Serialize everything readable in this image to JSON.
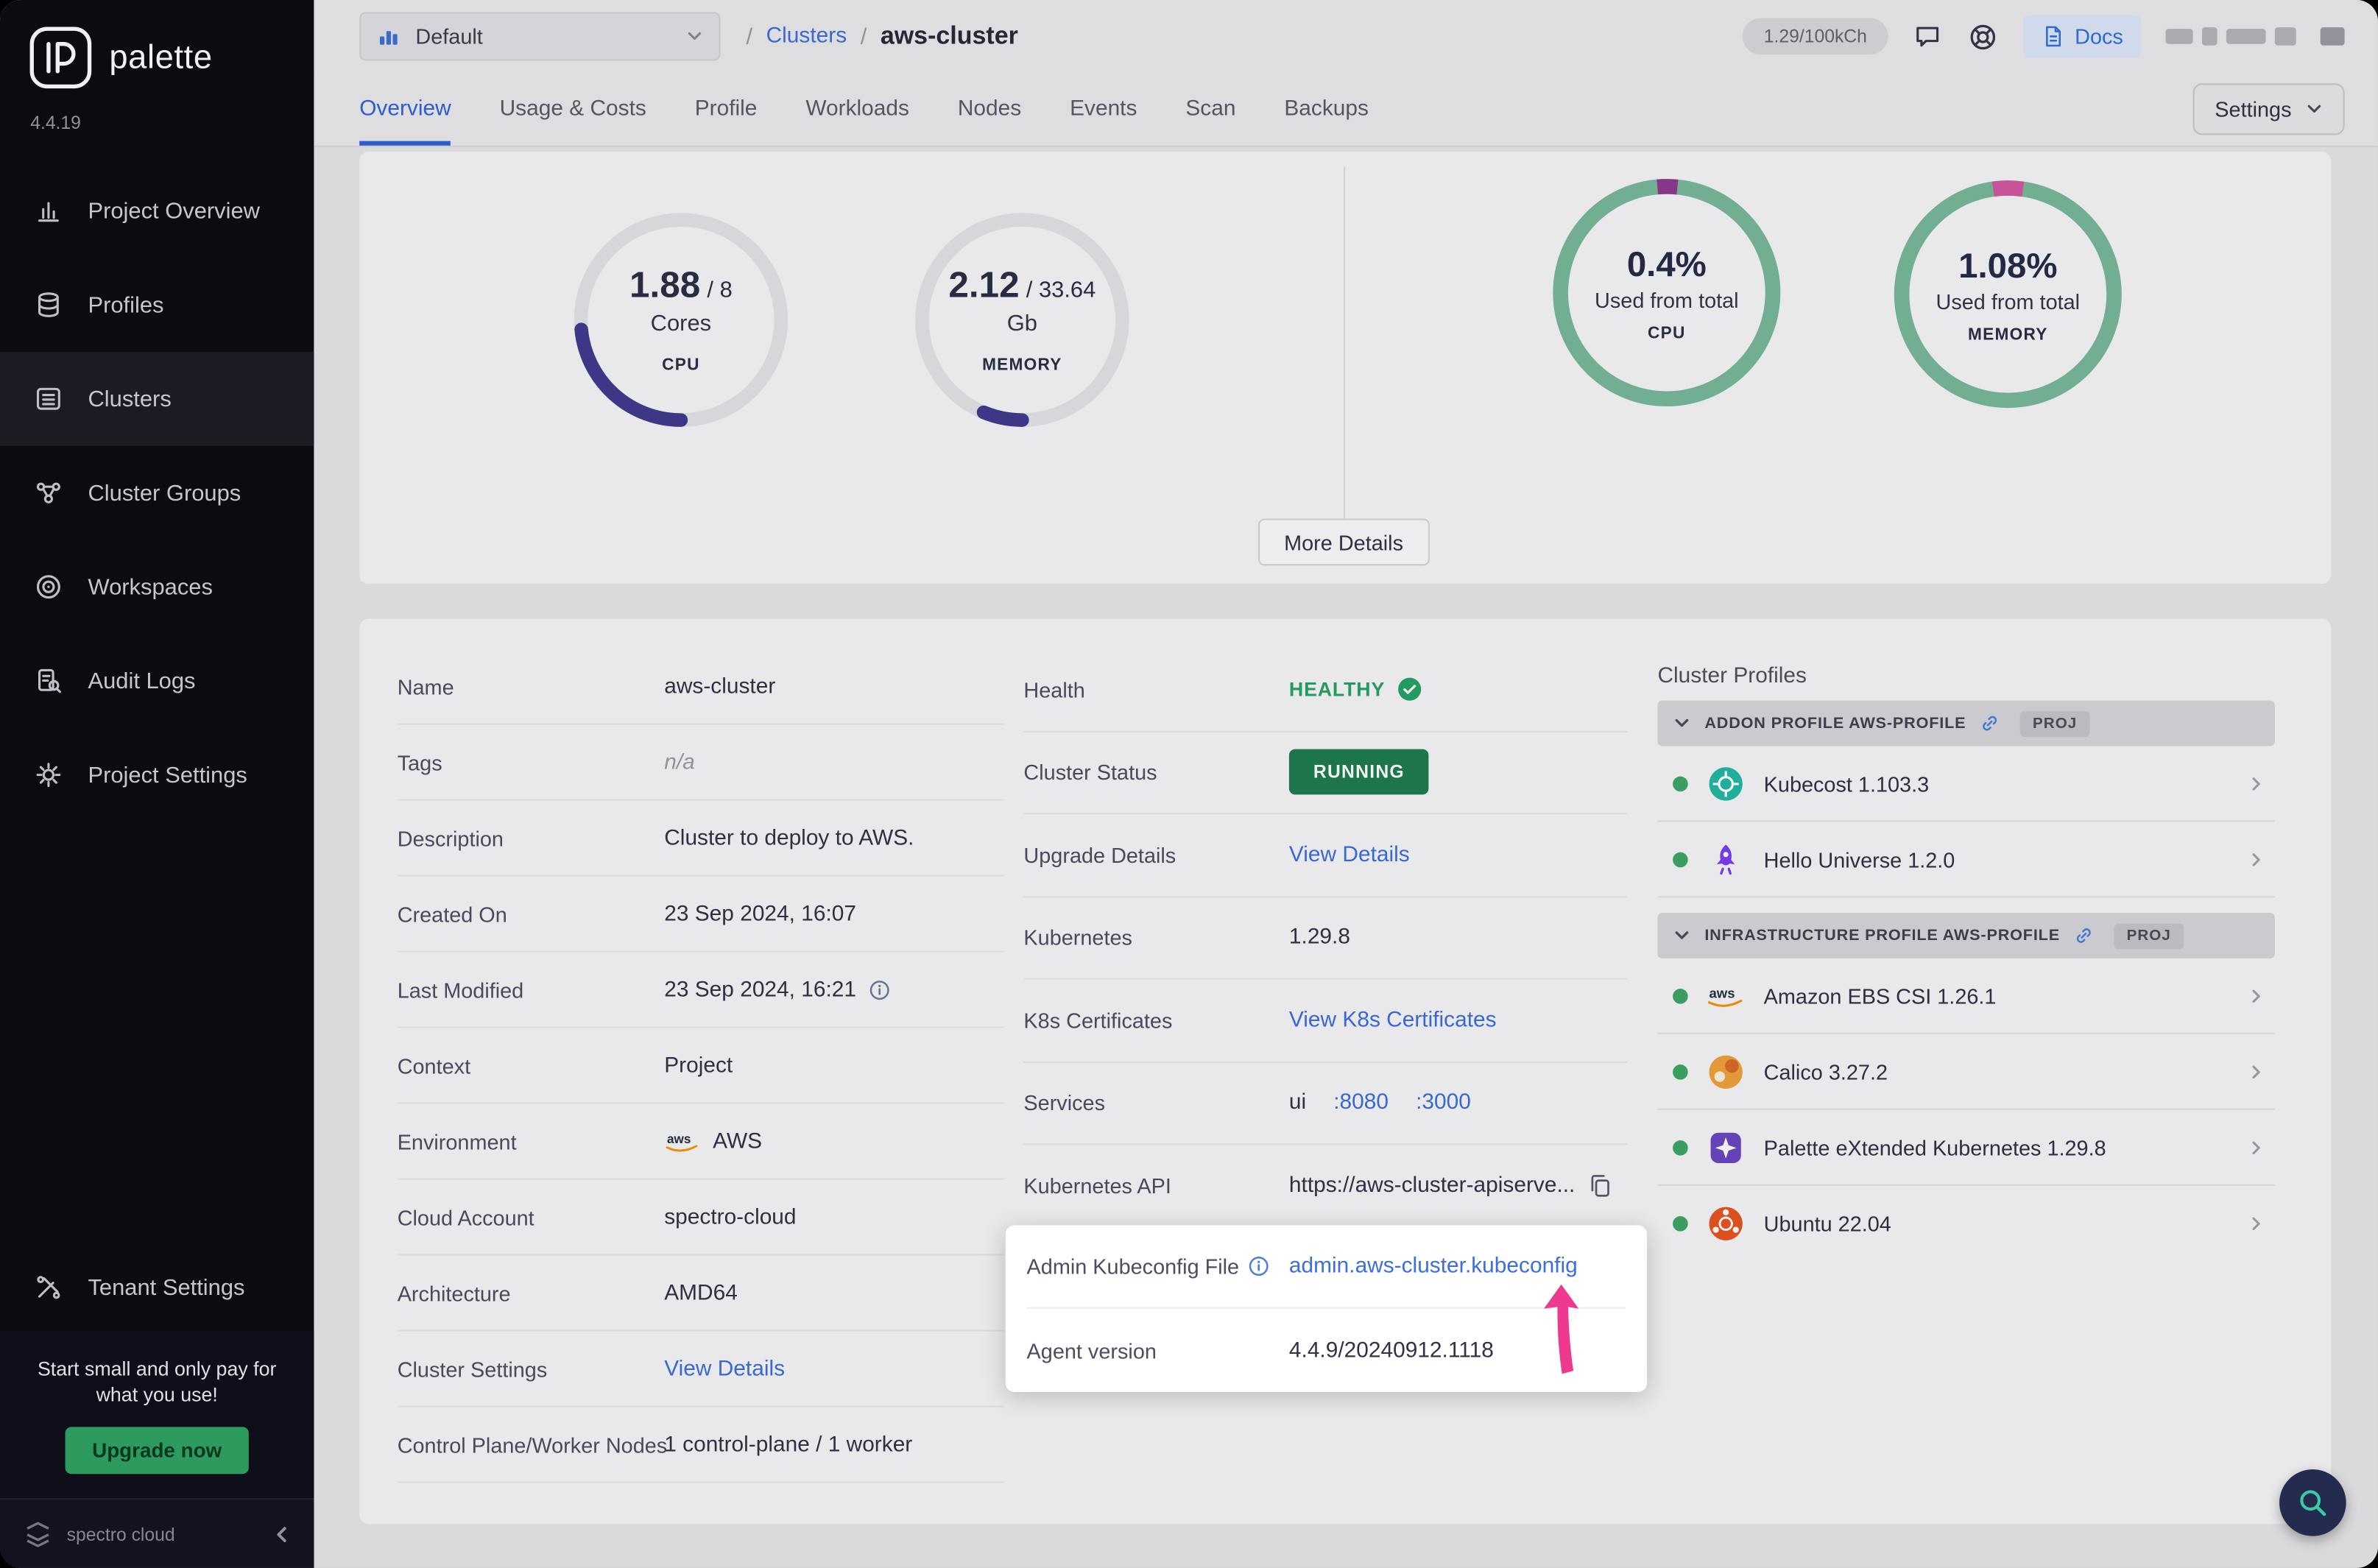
{
  "sidebar": {
    "brand": "palette",
    "version": "4.4.19",
    "items": [
      {
        "label": "Project Overview"
      },
      {
        "label": "Profiles"
      },
      {
        "label": "Clusters"
      },
      {
        "label": "Cluster Groups"
      },
      {
        "label": "Workspaces"
      },
      {
        "label": "Audit Logs"
      },
      {
        "label": "Project Settings"
      }
    ],
    "tenant_settings": "Tenant Settings",
    "promo_text": "Start small and only pay for what you use!",
    "upgrade_label": "Upgrade now",
    "footer_brand": "spectro cloud"
  },
  "topbar": {
    "project_selector": "Default",
    "breadcrumb": {
      "sep": "/",
      "root": "Clusters",
      "current": "aws-cluster"
    },
    "usage_pill": "1.29/100kCh",
    "docs": "Docs"
  },
  "tabs": {
    "items": [
      {
        "label": "Overview"
      },
      {
        "label": "Usage & Costs"
      },
      {
        "label": "Profile"
      },
      {
        "label": "Workloads"
      },
      {
        "label": "Nodes"
      },
      {
        "label": "Events"
      },
      {
        "label": "Scan"
      },
      {
        "label": "Backups"
      }
    ],
    "settings": "Settings"
  },
  "metrics": {
    "cpu_gauge": {
      "value": "1.88",
      "total": "/ 8",
      "unit": "Cores",
      "label": "CPU",
      "dash": "23.5 100"
    },
    "memory_gauge": {
      "value": "2.12",
      "total": "/ 33.64",
      "unit": "Gb",
      "label": "MEMORY",
      "dash": "6.3 100"
    },
    "cpu_usage": {
      "percent": "0.4%",
      "caption": "Used from total",
      "label": "CPU",
      "dash": "3 100"
    },
    "memory_usage": {
      "percent": "1.08%",
      "caption": "Used from total",
      "label": "MEMORY",
      "dash": "4.5 100"
    },
    "more_details": "More Details"
  },
  "overview": {
    "left": [
      {
        "label": "Name",
        "value": "aws-cluster"
      },
      {
        "label": "Tags",
        "value": "n/a"
      },
      {
        "label": "Description",
        "value": "Cluster to deploy to AWS."
      },
      {
        "label": "Created On",
        "value": "23 Sep 2024, 16:07"
      },
      {
        "label": "Last Modified",
        "value": "23 Sep 2024, 16:21"
      },
      {
        "label": "Context",
        "value": "Project"
      },
      {
        "label": "Environment",
        "value": "AWS"
      },
      {
        "label": "Cloud Account",
        "value": "spectro-cloud"
      },
      {
        "label": "Architecture",
        "value": "AMD64"
      },
      {
        "label": "Cluster Settings",
        "value": "View Details"
      },
      {
        "label": "Control Plane/Worker Nodes",
        "value": "1 control-plane / 1 worker"
      }
    ],
    "mid": [
      {
        "label": "Health",
        "value": "HEALTHY"
      },
      {
        "label": "Cluster Status",
        "value": "RUNNING"
      },
      {
        "label": "Upgrade Details",
        "value": "View Details"
      },
      {
        "label": "Kubernetes",
        "value": "1.29.8"
      },
      {
        "label": "K8s Certificates",
        "value": "View K8s Certificates"
      },
      {
        "label": "Services",
        "value": "ui",
        "ports": [
          {
            "label": ":8080"
          },
          {
            "label": ":3000"
          }
        ]
      },
      {
        "label": "Kubernetes API",
        "value": "https://aws-cluster-apiserve..."
      }
    ],
    "spotlight": [
      {
        "label": "Admin Kubeconfig File",
        "value": "admin.aws-cluster.kubeconfig"
      },
      {
        "label": "Agent version",
        "value": "4.4.9/20240912.1118"
      }
    ]
  },
  "profiles_panel": {
    "title": "Cluster Profiles",
    "sections": [
      {
        "header": "ADDON PROFILE AWS-PROFILE",
        "badge": "PROJ",
        "items": [
          {
            "name": "Kubecost 1.103.3"
          },
          {
            "name": "Hello Universe 1.2.0"
          }
        ]
      },
      {
        "header": "INFRASTRUCTURE PROFILE AWS-PROFILE",
        "badge": "PROJ",
        "items": [
          {
            "name": "Amazon EBS CSI 1.26.1"
          },
          {
            "name": "Calico 3.27.2"
          },
          {
            "name": "Palette eXtended Kubernetes 1.29.8"
          },
          {
            "name": "Ubuntu 22.04"
          }
        ]
      }
    ]
  }
}
